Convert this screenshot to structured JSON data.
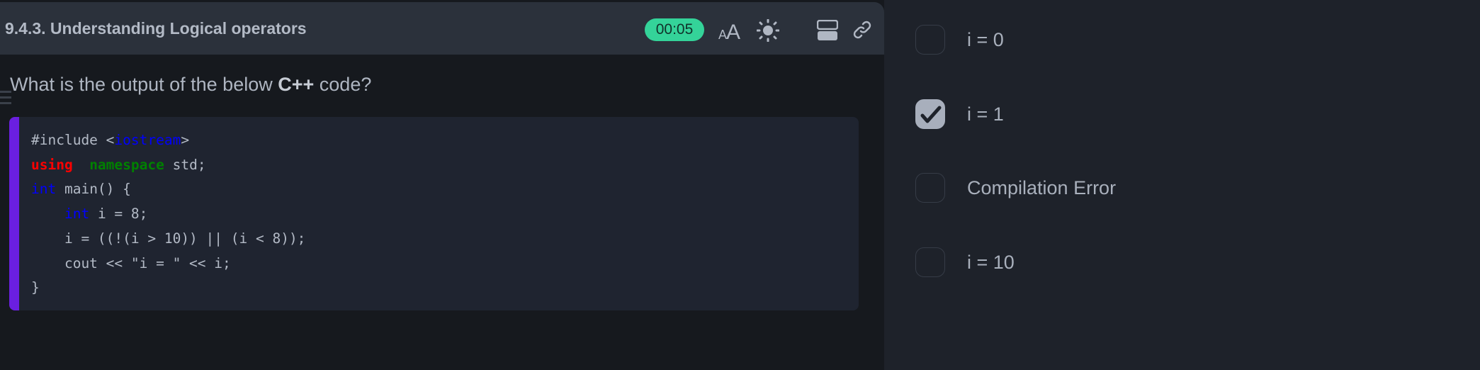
{
  "header": {
    "title": "9.4.3. Understanding Logical operators",
    "timer": "00:05",
    "icons": [
      "font-size-icon",
      "sun-icon",
      "layout-icon",
      "link-icon"
    ]
  },
  "question": {
    "prefix": "What is the output of the below ",
    "language": "C++",
    "suffix": " code?"
  },
  "code": {
    "lines": [
      [
        {
          "t": "#include <",
          "c": ""
        },
        {
          "t": "iostream",
          "c": "kw-blue"
        },
        {
          "t": ">",
          "c": ""
        }
      ],
      [
        {
          "t": "using",
          "c": "kw-red"
        },
        {
          "t": "  ",
          "c": ""
        },
        {
          "t": "namespace",
          "c": "kw-green"
        },
        {
          "t": " std;",
          "c": ""
        }
      ],
      [
        {
          "t": "int",
          "c": "kw-blue"
        },
        {
          "t": " main() {",
          "c": ""
        }
      ],
      [
        {
          "t": "    ",
          "c": ""
        },
        {
          "t": "int",
          "c": "kw-blue"
        },
        {
          "t": " i = 8;",
          "c": ""
        }
      ],
      [
        {
          "t": "    i = ((!(i > 10)) || (i < 8));",
          "c": ""
        }
      ],
      [
        {
          "t": "    cout << \"i = \" << i;",
          "c": ""
        }
      ],
      [
        {
          "t": "}",
          "c": ""
        }
      ]
    ]
  },
  "options": [
    {
      "label": "i = 0",
      "checked": false
    },
    {
      "label": "i = 1",
      "checked": true
    },
    {
      "label": "Compilation Error",
      "checked": false
    },
    {
      "label": "i = 10",
      "checked": false
    }
  ],
  "colors": {
    "timer": "#34d399",
    "accent_bar": "#6a1fe0"
  }
}
